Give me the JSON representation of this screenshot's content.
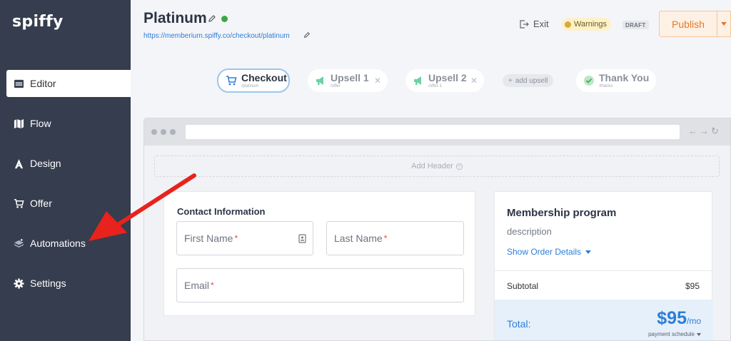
{
  "app": {
    "logo": "spiffy"
  },
  "sidebar": {
    "items": [
      {
        "label": "Editor",
        "icon": "editor-icon",
        "active": true
      },
      {
        "label": "Flow",
        "icon": "map-icon"
      },
      {
        "label": "Design",
        "icon": "design-icon"
      },
      {
        "label": "Offer",
        "icon": "cart-icon"
      },
      {
        "label": "Automations",
        "icon": "layers-icon"
      },
      {
        "label": "Settings",
        "icon": "gear-icon"
      }
    ]
  },
  "header": {
    "title": "Platinum",
    "url": "https://memberium.spiffy.co/checkout/platinum",
    "exit_label": "Exit",
    "warnings_label": "Warnings",
    "draft_label": "DRAFT",
    "publish_label": "Publish"
  },
  "steps": [
    {
      "label": "Checkout",
      "sub": "/platinum",
      "icon": "cart-icon"
    },
    {
      "label": "Upsell 1",
      "sub": "/offer",
      "icon": "megaphone-icon"
    },
    {
      "label": "Upsell 2",
      "sub": "/offer-1",
      "icon": "megaphone-icon"
    },
    {
      "label": "Thank You",
      "sub": "/thanks",
      "icon": "check-circle-icon"
    }
  ],
  "add_upsell_label": "add upsell",
  "preview": {
    "add_header_label": "Add Header",
    "contact": {
      "heading": "Contact Information",
      "first_name_placeholder": "First Name",
      "last_name_placeholder": "Last Name",
      "email_placeholder": "Email",
      "required_mark": "*"
    },
    "order": {
      "title": "Membership program",
      "description": "description",
      "show_details": "Show Order Details",
      "subtotal_label": "Subtotal",
      "subtotal_value": "$95",
      "total_label": "Total:",
      "total_amount": "$95",
      "total_unit": "/mo",
      "schedule_label": "payment schedule"
    }
  },
  "colors": {
    "sidebar_bg": "#353d4e",
    "accent_blue": "#2d7ed8",
    "publish_orange": "#e27b2a",
    "annotation_red": "#e8221c"
  }
}
